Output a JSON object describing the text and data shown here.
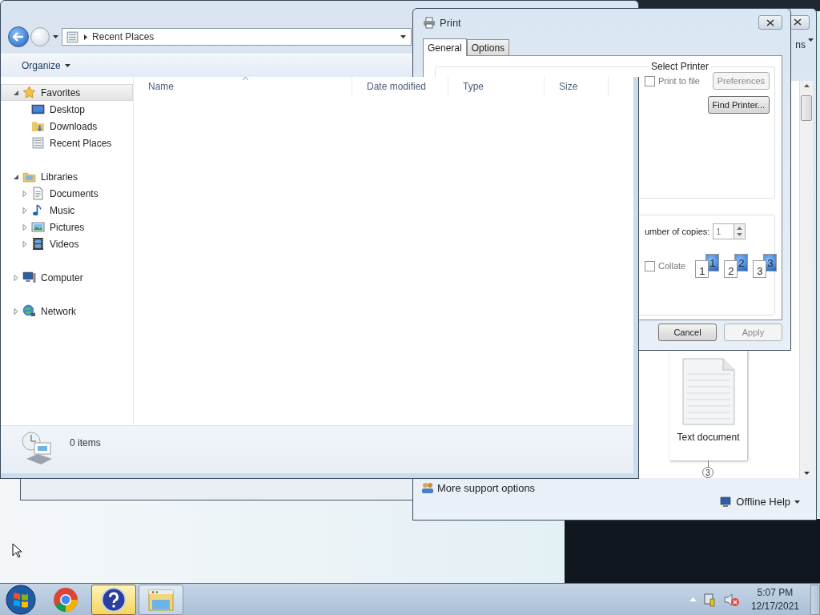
{
  "explorer": {
    "address": "Recent Places",
    "toolbar": [
      {
        "label": "Organize"
      }
    ],
    "nav_tree": [
      {
        "kind": "star",
        "label": "Favorites",
        "expanded": true,
        "selected": true,
        "children": [
          {
            "kind": "desktop",
            "label": "Desktop",
            "selected": false
          },
          {
            "kind": "downloads",
            "label": "Downloads",
            "selected": false
          },
          {
            "kind": "recent",
            "label": "Recent Places",
            "selected": false
          }
        ]
      },
      {
        "kind": "library",
        "label": "Libraries",
        "expanded": true,
        "selected": false,
        "children": [
          {
            "kind": "documents",
            "label": "Documents",
            "expanded": false,
            "selected": false
          },
          {
            "kind": "music",
            "label": "Music",
            "expanded": false,
            "selected": false
          },
          {
            "kind": "pictures",
            "label": "Pictures",
            "expanded": false,
            "selected": false
          },
          {
            "kind": "videos",
            "label": "Videos",
            "expanded": false,
            "selected": false
          }
        ]
      },
      {
        "kind": "computer",
        "label": "Computer",
        "expanded": false,
        "selected": false
      },
      {
        "kind": "network",
        "label": "Network",
        "expanded": false,
        "selected": false
      }
    ],
    "columns": [
      {
        "label": "Name",
        "sorted": true
      },
      {
        "label": "Date modified",
        "sorted": false
      },
      {
        "label": "Type",
        "sorted": false
      },
      {
        "label": "Size",
        "sorted": false
      }
    ],
    "status": "0 items"
  },
  "print_dialog": {
    "title": "Print",
    "tabs": [
      {
        "label": "General",
        "selected": true
      },
      {
        "label": "Options",
        "selected": false
      }
    ],
    "printer_group": "Select Printer",
    "print_to_file": {
      "label": "Print to file",
      "checked": false
    },
    "printer_buttons": [
      {
        "label": "Preferences",
        "disabled": true
      },
      {
        "label": "Find Printer...",
        "disabled": false
      }
    ],
    "copies_label": "umber of copies:",
    "copies": "1",
    "collate": {
      "label": "Collate",
      "checked": false
    },
    "collate_pages": [
      [
        "1",
        "1"
      ],
      [
        "2",
        "2"
      ],
      [
        "3",
        "3"
      ]
    ],
    "footer_buttons": [
      {
        "label": "Cancel",
        "disabled": false
      },
      {
        "label": "Apply",
        "disabled": true
      }
    ]
  },
  "help_window": {
    "toolbar_fragment": "ns",
    "document_label": "Text document",
    "step": "3",
    "support_link": "More support options",
    "offline_help": "Offline Help"
  },
  "taskbar": {
    "apps": [
      {
        "kind": "browser",
        "active": false
      },
      {
        "kind": "help",
        "active": true
      },
      {
        "kind": "explorer",
        "active": false
      }
    ],
    "time": "5:07 PM",
    "date": "12/17/2021"
  }
}
